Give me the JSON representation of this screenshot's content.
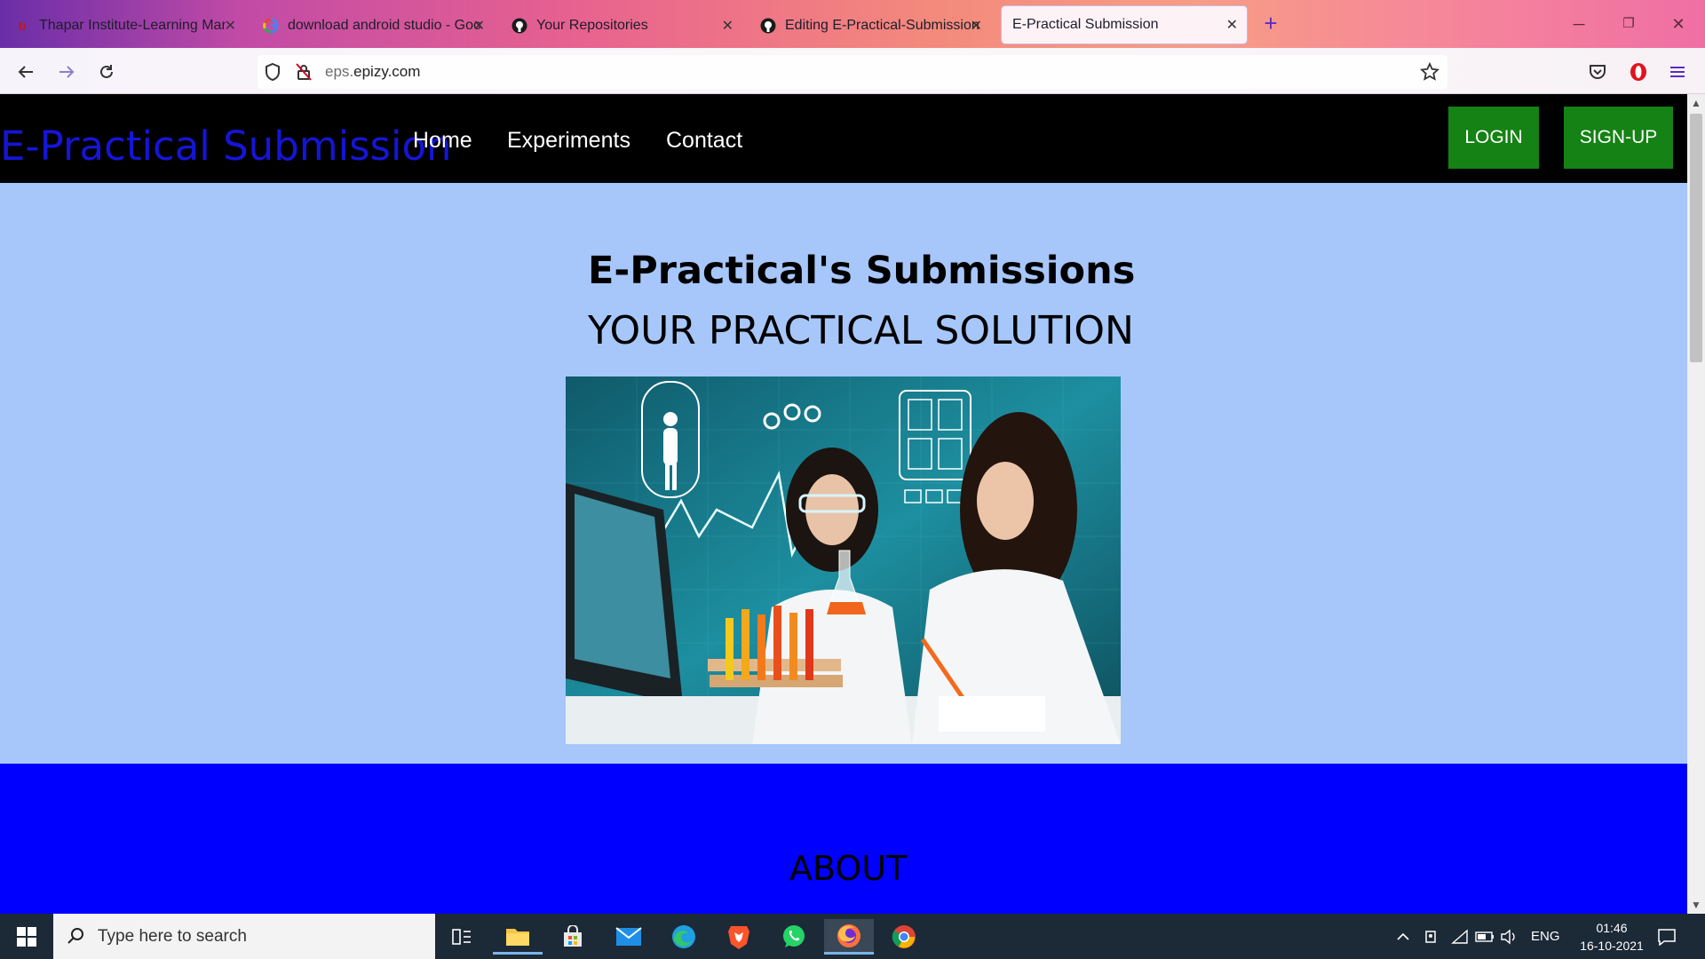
{
  "browser": {
    "tabs": [
      {
        "label": "Thapar Institute-Learning Mana",
        "icon": "thapar-logo-icon"
      },
      {
        "label": "download android studio - Goo",
        "icon": "google-g-icon"
      },
      {
        "label": "Your Repositories",
        "icon": "github-icon"
      },
      {
        "label": "Editing E-Practical-Submissions",
        "icon": "github-icon"
      },
      {
        "label": "E-Practical Submission",
        "icon": "none",
        "active": true
      }
    ],
    "url_domain_dim": "eps.",
    "url_domain_main": "epizy.com"
  },
  "site": {
    "brand": "E-Practical Submission",
    "nav": [
      "Home",
      "Experiments",
      "Contact"
    ],
    "login_label": "LOGIN",
    "signup_label": "SIGN-UP",
    "hero_title": "E-Practical's Submissions",
    "hero_subtitle": "YOUR PRACTICAL SOLUTION",
    "about_heading": "ABOUT",
    "colors": {
      "brand": "#1515d8",
      "button": "#148214",
      "hero_bg": "#a7c7fb",
      "about_bg": "#0000fe"
    }
  },
  "taskbar": {
    "search_placeholder": "Type here to search",
    "language": "ENG",
    "time": "01:46",
    "date": "16-10-2021",
    "pinned": [
      "task-view-icon",
      "file-explorer-icon",
      "store-icon",
      "mail-icon",
      "edge-icon",
      "brave-icon",
      "whatsapp-icon",
      "firefox-icon",
      "chrome-icon"
    ]
  }
}
